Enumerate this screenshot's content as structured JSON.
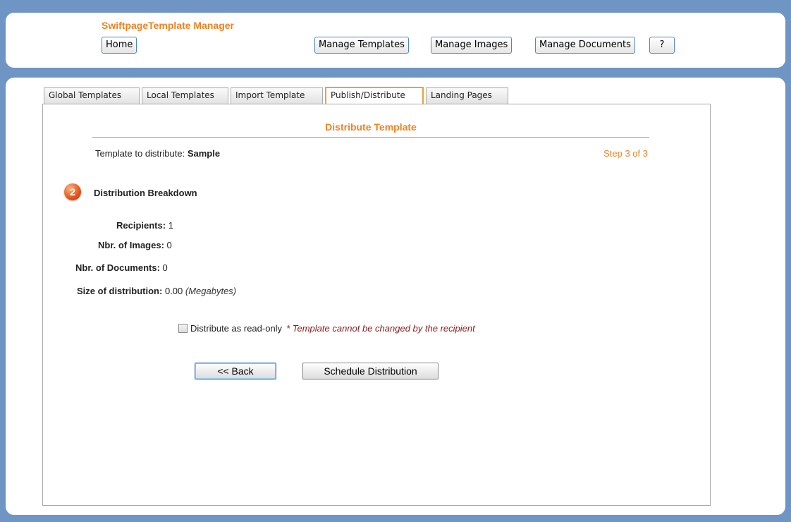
{
  "header": {
    "app_title": "SwiftpageTemplate Manager",
    "home_label": "Home",
    "nav": [
      {
        "label": "Manage Templates"
      },
      {
        "label": "Manage Images"
      },
      {
        "label": "Manage Documents"
      },
      {
        "label": "?"
      }
    ]
  },
  "tabs": [
    {
      "label": "Global Templates"
    },
    {
      "label": "Local Templates"
    },
    {
      "label": "Import Template"
    },
    {
      "label": "Publish/Distribute",
      "active": true
    },
    {
      "label": "Landing Pages"
    }
  ],
  "panel": {
    "title": "Distribute Template",
    "template_prefix": "Template to distribute:",
    "template_name": "Sample",
    "step": "Step 3 of 3",
    "badge_number": "2",
    "section_title": "Distribution Breakdown",
    "stats": {
      "recipients_label": "Recipients:",
      "recipients_value": "1",
      "images_label": "Nbr. of Images:",
      "images_value": "0",
      "documents_label": "Nbr. of Documents:",
      "documents_value": "0",
      "size_label": "Size of distribution:",
      "size_value": "0.00",
      "size_unit": "(Megabytes)"
    },
    "readonly": {
      "label": "Distribute as read-only",
      "checked": false,
      "note": "* Template cannot be changed by the recipient"
    },
    "back_label": "<< Back",
    "schedule_label": "Schedule Distribution"
  },
  "colors": {
    "background": "#6e95c4",
    "accent_orange": "#f0811f",
    "note_red": "#8b1a1a",
    "button_border": "#4f84c3"
  }
}
